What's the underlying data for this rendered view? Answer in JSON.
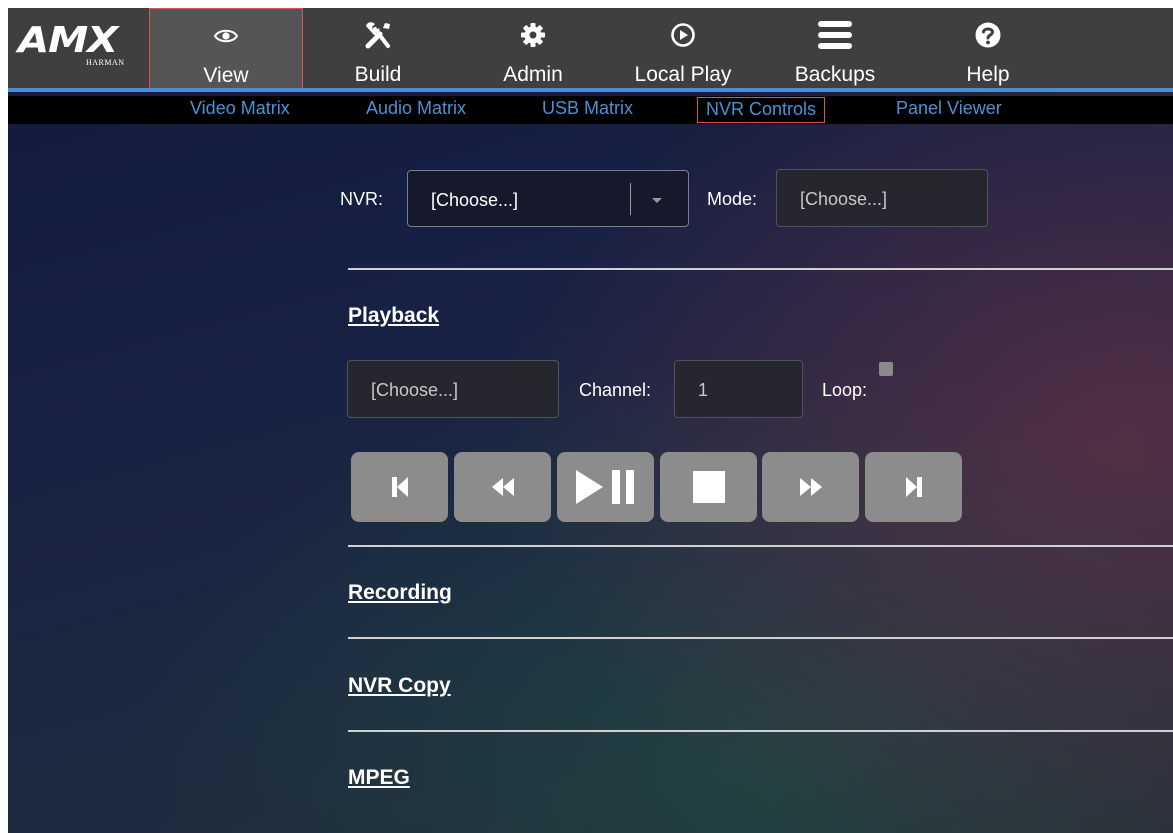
{
  "colors": {
    "accent": "#4a8fd0",
    "active_outline": "#d9534f",
    "nav_background": "#3f3f3f",
    "button_gray": "#8c8c8c"
  },
  "logo": {
    "word": "AMX",
    "sub": "HARMAN"
  },
  "nav": {
    "items": [
      {
        "label": "View",
        "icon": "eye-icon",
        "active": true
      },
      {
        "label": "Build",
        "icon": "tools-icon"
      },
      {
        "label": "Admin",
        "icon": "gear-icon"
      },
      {
        "label": "Local Play",
        "icon": "play-circle-icon"
      },
      {
        "label": "Backups",
        "icon": "menu-icon"
      },
      {
        "label": "Help",
        "icon": "help-circle-icon"
      }
    ]
  },
  "subnav": {
    "items": [
      {
        "label": "Video Matrix"
      },
      {
        "label": "Audio Matrix"
      },
      {
        "label": "USB Matrix"
      },
      {
        "label": "NVR Controls",
        "active": true
      },
      {
        "label": "Panel Viewer"
      }
    ]
  },
  "controls": {
    "nvr_label": "NVR:",
    "nvr_value": "[Choose...]",
    "mode_label": "Mode:",
    "mode_value": "[Choose...]"
  },
  "sections": {
    "playback": {
      "title": "Playback",
      "source_value": "[Choose...]",
      "channel_label": "Channel:",
      "channel_value": "1",
      "loop_label": "Loop:",
      "loop_checked": false,
      "buttons": [
        {
          "icon": "skip-back-icon"
        },
        {
          "icon": "rewind-icon"
        },
        {
          "icon": "play-pause-icon"
        },
        {
          "icon": "stop-icon"
        },
        {
          "icon": "fast-forward-icon"
        },
        {
          "icon": "skip-forward-icon"
        }
      ]
    },
    "recording": {
      "title": "Recording"
    },
    "nvr_copy": {
      "title": "NVR Copy"
    },
    "mpeg": {
      "title": "MPEG"
    }
  }
}
